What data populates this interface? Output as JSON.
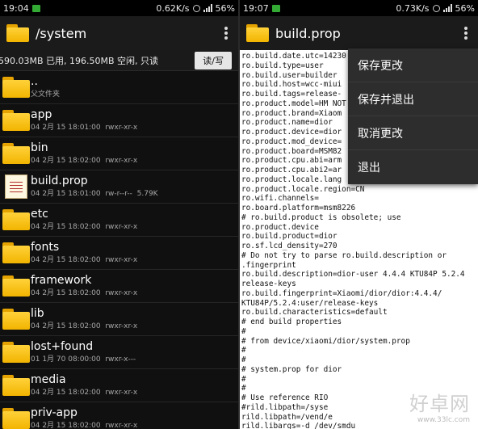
{
  "left": {
    "status": {
      "time": "19:04",
      "speed": "0.62K/s",
      "battery": "56%"
    },
    "title": "/system",
    "storage_info": "590.03MB 已用, 196.50MB 空闲, 只读",
    "rw_button": "读/写",
    "files": [
      {
        "name": "..",
        "meta": "父文件夹",
        "icon": "folder-icon"
      },
      {
        "name": "app",
        "meta": "04 2月 15 18:01:00  rwxr-xr-x",
        "icon": "folder-icon"
      },
      {
        "name": "bin",
        "meta": "04 2月 15 18:02:00  rwxr-xr-x",
        "icon": "folder-icon"
      },
      {
        "name": "build.prop",
        "meta": "04 2月 15 18:01:00  rw-r--r--  5.79K",
        "icon": "text-file-icon"
      },
      {
        "name": "etc",
        "meta": "04 2月 15 18:02:00  rwxr-xr-x",
        "icon": "folder-icon"
      },
      {
        "name": "fonts",
        "meta": "04 2月 15 18:02:00  rwxr-xr-x",
        "icon": "folder-icon"
      },
      {
        "name": "framework",
        "meta": "04 2月 15 18:02:00  rwxr-xr-x",
        "icon": "folder-icon"
      },
      {
        "name": "lib",
        "meta": "04 2月 15 18:02:00  rwxr-xr-x",
        "icon": "folder-icon"
      },
      {
        "name": "lost+found",
        "meta": "01 1月 70 08:00:00  rwxr-x---",
        "icon": "folder-icon"
      },
      {
        "name": "media",
        "meta": "04 2月 15 18:02:00  rwxr-xr-x",
        "icon": "folder-icon"
      },
      {
        "name": "priv-app",
        "meta": "04 2月 15 18:02:00  rwxr-xr-x",
        "icon": "folder-icon"
      }
    ]
  },
  "right": {
    "status": {
      "time": "19:07",
      "speed": "0.73K/s",
      "battery": "56%"
    },
    "title": "build.prop",
    "editor_text": "ro.build.date.utc=14230\nro.build.type=user\nro.build.user=builder\nro.build.host=wcc-miui\nro.build.tags=release-\nro.product.model=HM NOT\nro.product.brand=Xiaom\nro.product.name=dior\nro.product.device=dior\nro.product.mod_device=\nro.product.board=MSM82\nro.product.cpu.abi=arm\nro.product.cpu.abi2=ar\nro.product.locale.lang\nro.product.locale.region=CN\nro.wifi.channels=\nro.board.platform=msm8226\n# ro.build.product is obsolete; use\nro.product.device\nro.build.product=dior\nro.sf.lcd_density=270\n# Do not try to parse ro.build.description or\n.fingerprint\nro.build.description=dior-user 4.4.4 KTU84P 5.2.4\nrelease-keys\nro.build.fingerprint=Xiaomi/dior/dior:4.4.4/\nKTU84P/5.2.4:user/release-keys\nro.build.characteristics=default\n# end build properties\n#\n# from device/xiaomi/dior/system.prop\n#\n#\n# system.prop for dior\n#\n#\n# Use reference RIO\n#rild.libpath=/syse\nrild.libpath=/vend/e\nrild.libargs=-d /dev/smdu",
    "menu": [
      "保存更改",
      "保存并退出",
      "取消更改",
      "退出"
    ]
  },
  "watermark": {
    "text": "好卓网",
    "url": "www.33lc.com"
  }
}
